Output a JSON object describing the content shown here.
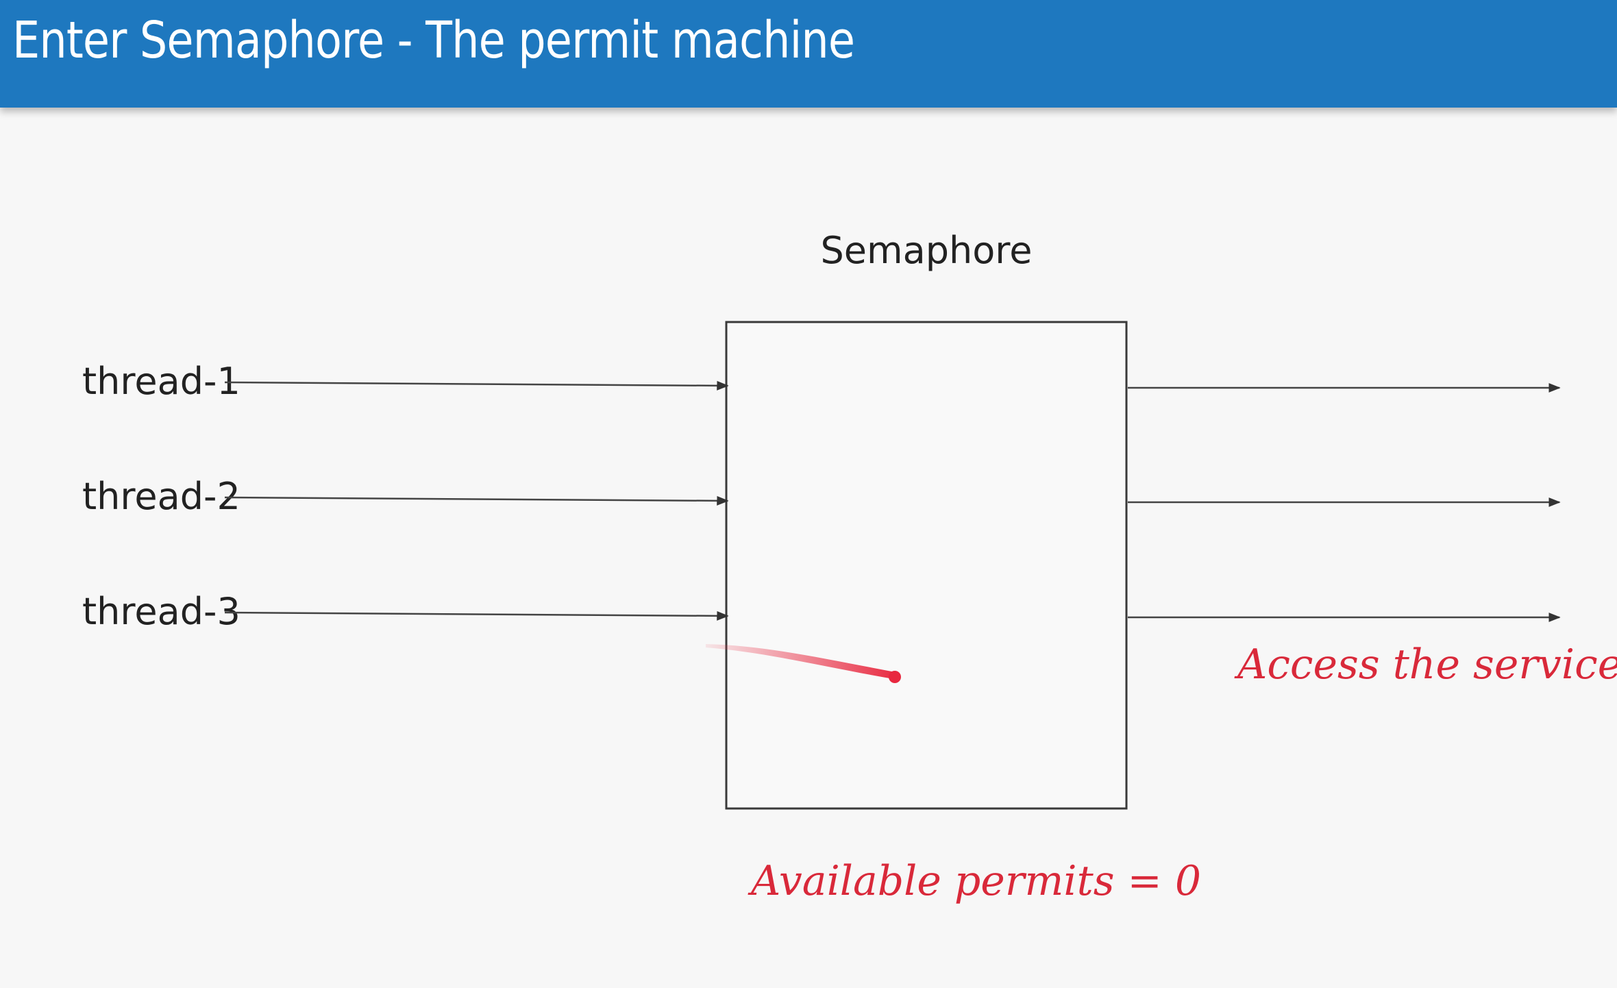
{
  "slide": {
    "title": "Enter Semaphore - The permit machine",
    "title_bar_color": "#1e78bf",
    "background_color": "#f7f7f7"
  },
  "diagram": {
    "semaphore_label": "Semaphore",
    "threads": [
      {
        "label": "thread-1"
      },
      {
        "label": "thread-2"
      },
      {
        "label": "thread-3"
      }
    ],
    "output_arrow_count": 3,
    "annotations": {
      "service_note": "Access the service",
      "permits_note": "Available permits = 0",
      "ink_color": "#d9293a"
    }
  }
}
